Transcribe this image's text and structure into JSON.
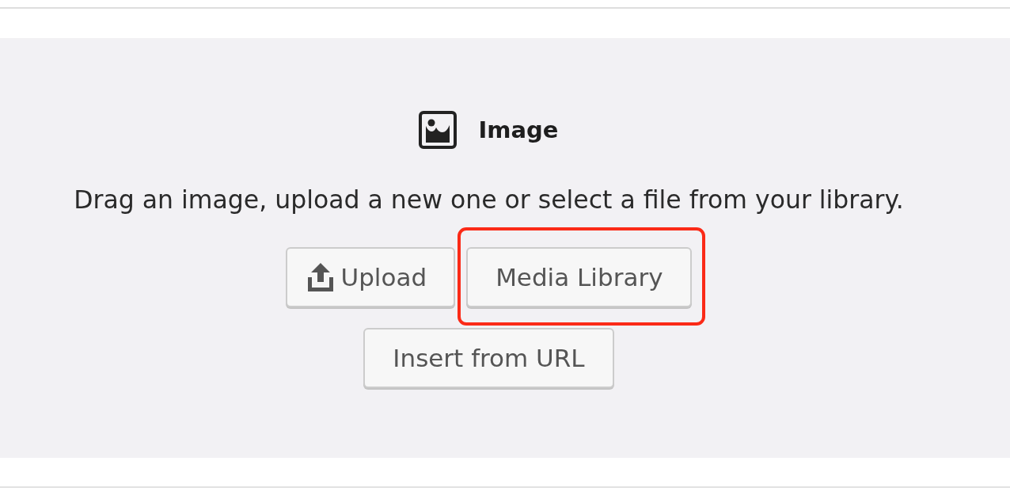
{
  "block": {
    "title": "Image",
    "description": "Drag an image, upload a new one or select a file from your library.",
    "buttons": [
      {
        "kind": "upload",
        "label": "Upload",
        "highlighted": false
      },
      {
        "kind": "plain",
        "label": "Media Library",
        "highlighted": true
      },
      {
        "kind": "plain",
        "label": "Insert from URL",
        "highlighted": false
      }
    ]
  }
}
